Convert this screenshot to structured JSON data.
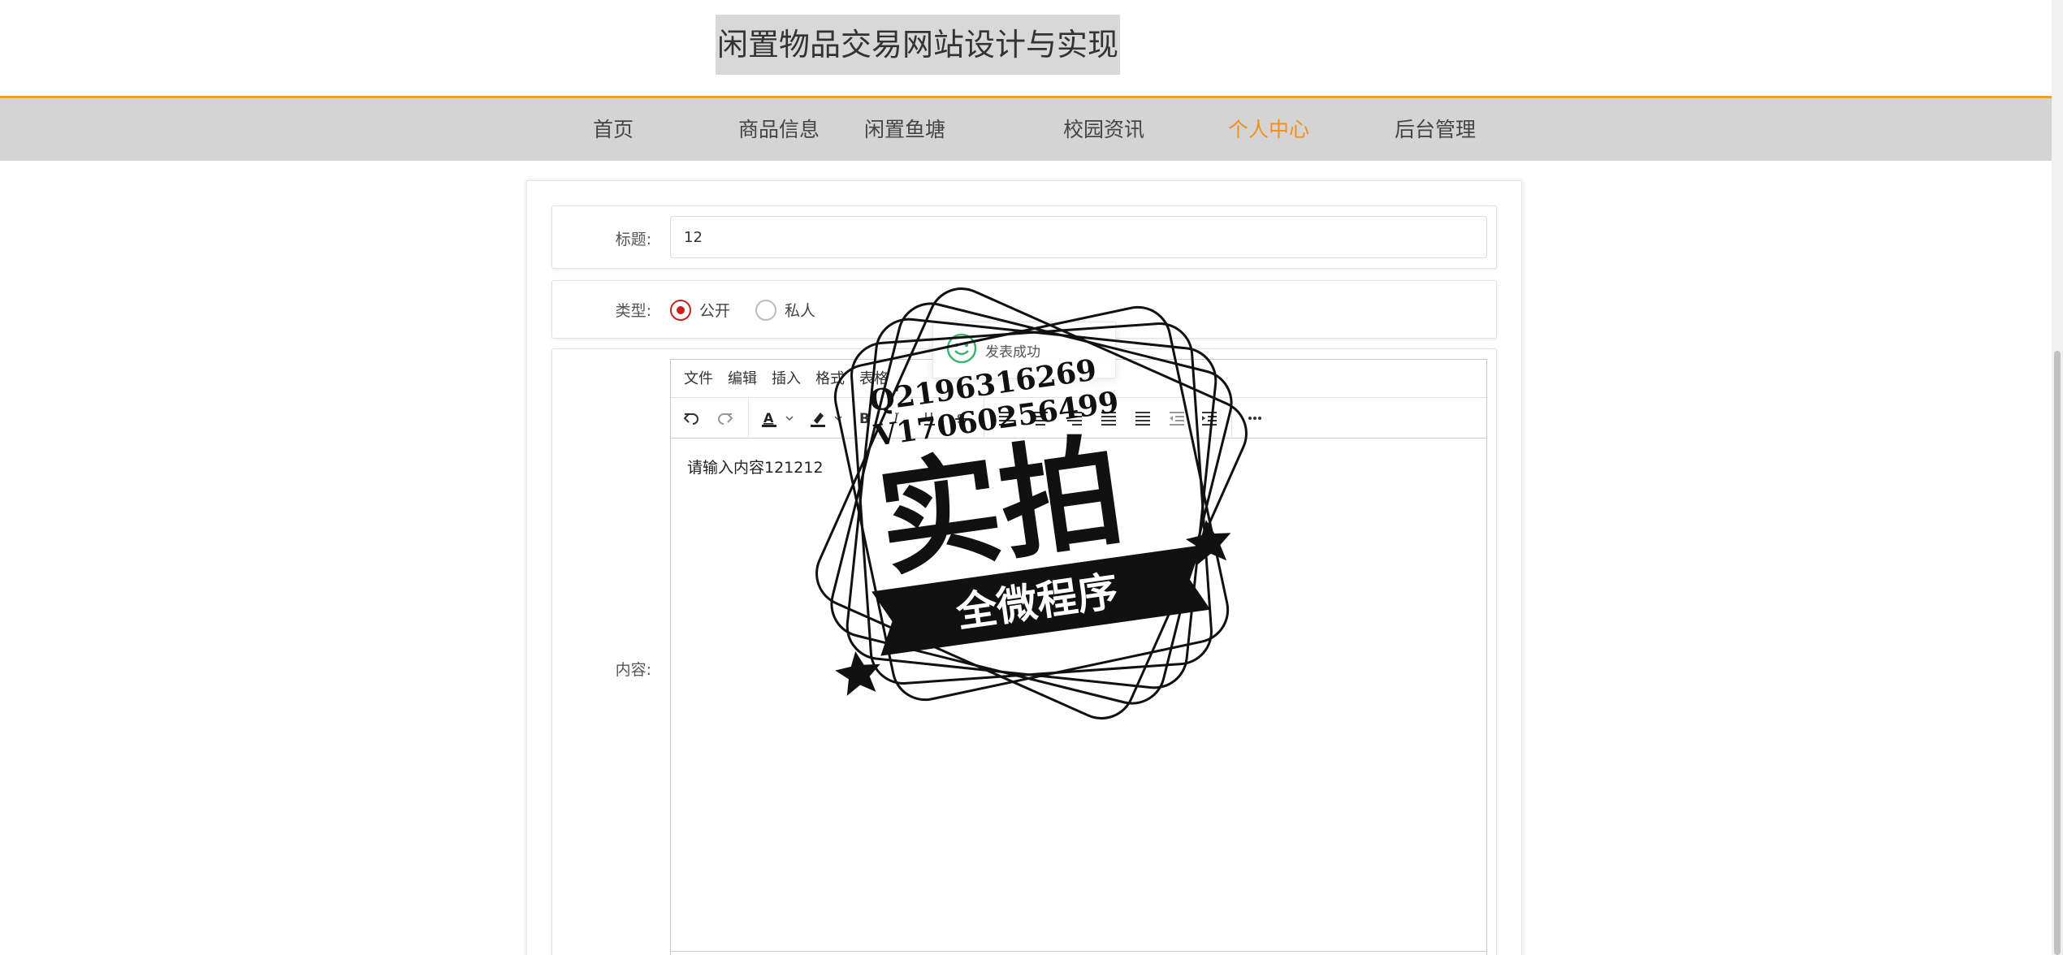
{
  "header": {
    "site_title": "闲置物品交易网站设计与实现"
  },
  "nav": {
    "items": [
      {
        "label": "首页",
        "active": false
      },
      {
        "label": "商品信息",
        "active": false
      },
      {
        "label": "闲置鱼塘",
        "active": false
      },
      {
        "label": "校园资讯",
        "active": false
      },
      {
        "label": "个人中心",
        "active": true
      },
      {
        "label": "后台管理",
        "active": false
      }
    ]
  },
  "form": {
    "title_label": "标题:",
    "title_value": "12",
    "type_label": "类型:",
    "type_options": [
      {
        "label": "公开",
        "checked": true
      },
      {
        "label": "私人",
        "checked": false
      }
    ],
    "content_label": "内容:"
  },
  "editor": {
    "menus": [
      "文件",
      "编辑",
      "插入",
      "格式",
      "表格"
    ],
    "toolbar_icons": [
      "undo-icon",
      "redo-icon",
      "text-color-icon",
      "highlight-icon",
      "bold-icon",
      "italic-icon",
      "underline-icon",
      "strikethrough-icon",
      "align-left-icon",
      "align-center-icon",
      "align-right-icon",
      "align-justify-icon",
      "outdent-icon",
      "indent-icon",
      "more-icon"
    ],
    "content": "请输入内容121212"
  },
  "toast": {
    "message": "发表成功"
  },
  "watermark": {
    "line1": "Q2196316269",
    "line2": "V17060256499",
    "main": "实拍",
    "ribbon": "全微程序"
  },
  "colors": {
    "accent": "#f2901d",
    "radio_checked": "#c8211e",
    "nav_bg": "#d4d4d4",
    "toast_icon": "#3cb371"
  }
}
